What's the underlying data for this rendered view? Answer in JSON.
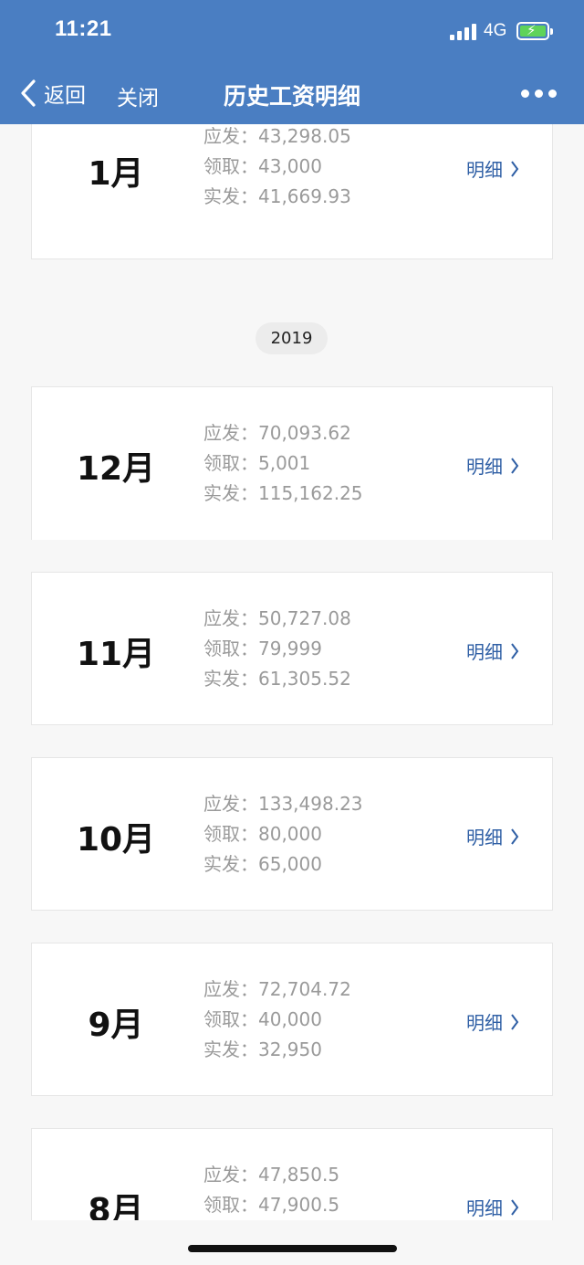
{
  "status_bar": {
    "time": "11:21",
    "network": "4G"
  },
  "nav": {
    "back_label": "返回",
    "close_label": "关闭",
    "title": "历史工资明细"
  },
  "labels": {
    "gross": "应发：",
    "received": "领取：",
    "net": "实发：",
    "detail": "明细"
  },
  "year_divider": "2019",
  "records": [
    {
      "month": "1月",
      "gross": "43,298.05",
      "received": "43,000",
      "net": "41,669.93"
    },
    {
      "month": "12月",
      "gross": "70,093.62",
      "received": "5,001",
      "net": "115,162.25"
    },
    {
      "month": "11月",
      "gross": "50,727.08",
      "received": "79,999",
      "net": "61,305.52"
    },
    {
      "month": "10月",
      "gross": "133,498.23",
      "received": "80,000",
      "net": "65,000"
    },
    {
      "month": "9月",
      "gross": "72,704.72",
      "received": "40,000",
      "net": "32,950"
    },
    {
      "month": "8月",
      "gross": "47,850.5",
      "received": "47,900.5",
      "net": ""
    }
  ],
  "colors": {
    "header": "#4a7ec2",
    "link": "#2f5fa5",
    "value_text": "#9a9a9a",
    "battery": "#5fd35a"
  },
  "icons": {
    "back": "chevron-left-icon",
    "more": "more-dots-icon",
    "detail": "chevron-right-icon"
  }
}
